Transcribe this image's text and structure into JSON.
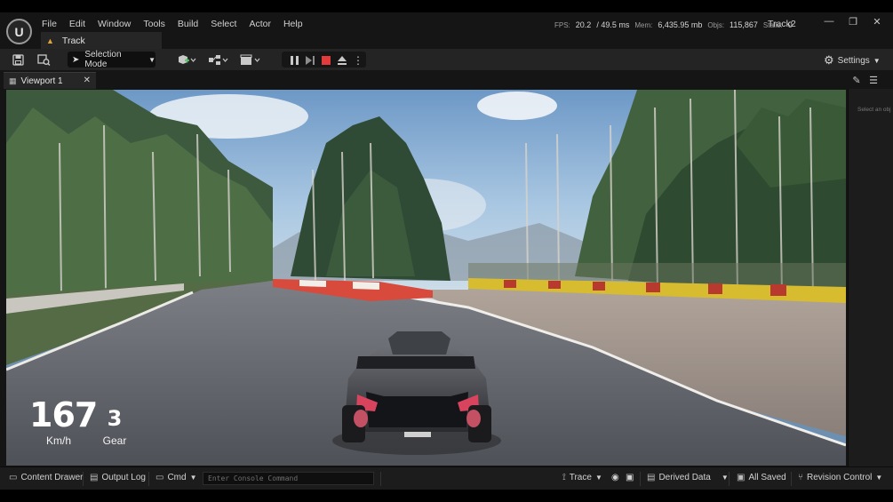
{
  "window": {
    "project_name": "Track2",
    "document_tab": "Track"
  },
  "menu": [
    "File",
    "Edit",
    "Window",
    "Tools",
    "Build",
    "Select",
    "Actor",
    "Help"
  ],
  "stats": {
    "fps_label": "FPS:",
    "fps_value": "20.2",
    "ms_value": "/ 49.5 ms",
    "mem_label": "Mem:",
    "mem_value": "6,435.95 mb",
    "objs_label": "Objs:",
    "objs_value": "115,867",
    "stalls_label": "Stalls:",
    "stalls_value": "0"
  },
  "toolbar": {
    "mode_label": "Selection Mode",
    "settings_label": "Settings"
  },
  "viewport_tab": {
    "label": "Viewport 1"
  },
  "side_panel": {
    "hint": "Select an obj"
  },
  "hud": {
    "speed": "167",
    "speed_unit": "Km/h",
    "gear": "3",
    "gear_label": "Gear"
  },
  "statusbar": {
    "content_drawer": "Content Drawer",
    "output_log": "Output Log",
    "cmd": "Cmd",
    "console_placeholder": "Enter Console Command",
    "trace": "Trace",
    "derived_data": "Derived Data",
    "all_saved": "All Saved",
    "revision_control": "Revision Control"
  },
  "colors": {
    "accent_orange": "#e2a23a",
    "stop_red": "#e23b3b",
    "sky": "#8fb3d6",
    "road": "#5a5b62"
  }
}
